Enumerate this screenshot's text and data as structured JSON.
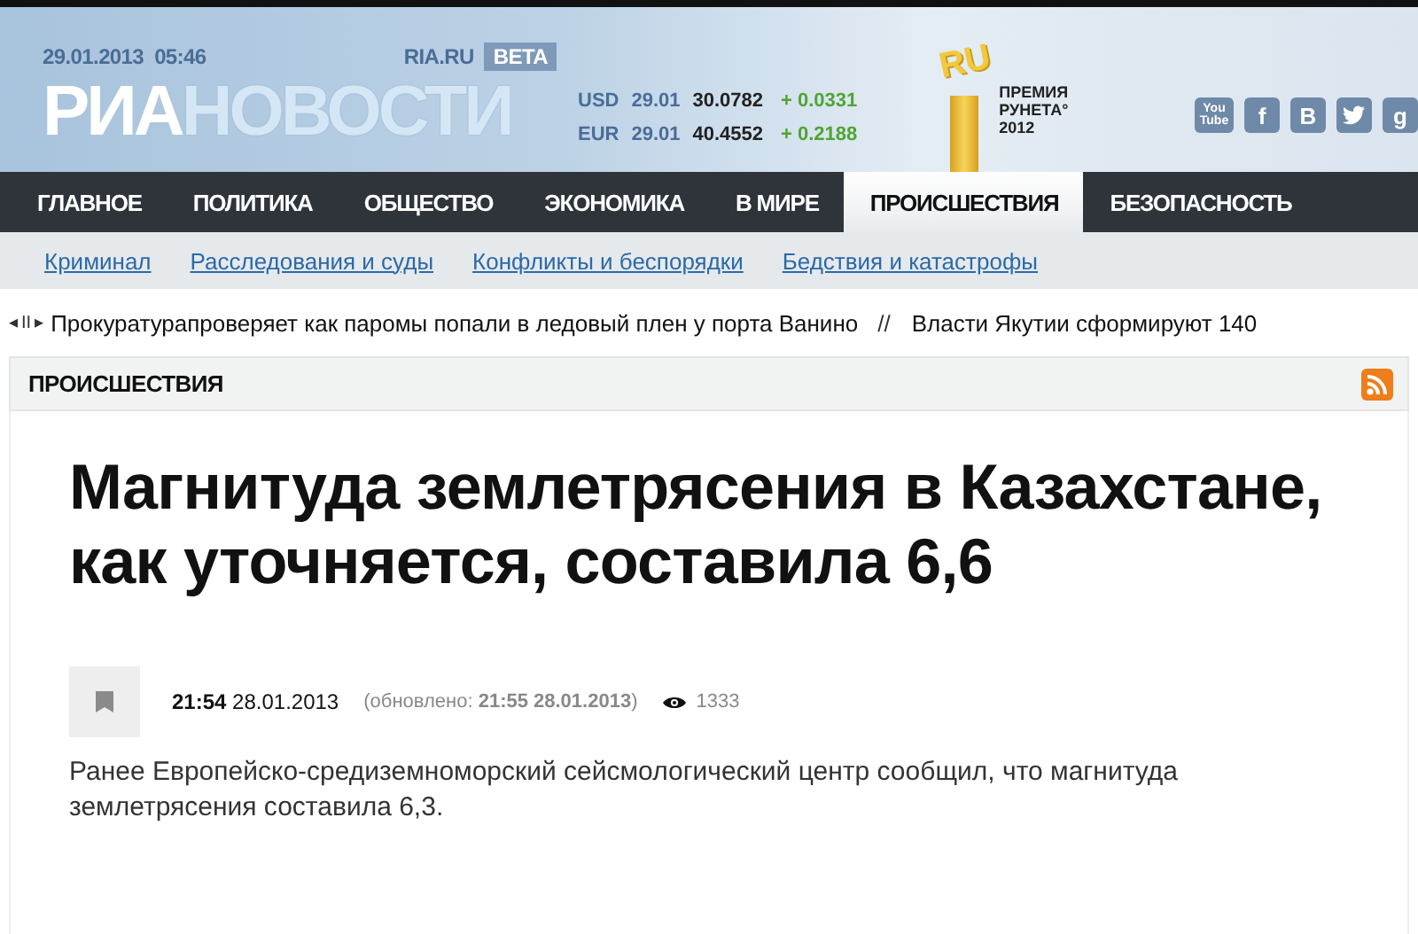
{
  "header": {
    "date": "29.01.2013",
    "time": "05:46",
    "site": "RIA.RU",
    "beta": "BETA",
    "logo": [
      "РИА",
      "НОВОСТИ"
    ],
    "rates": [
      {
        "currency": "USD",
        "date": "29.01",
        "value": "30.0782",
        "change": "+ 0.0331"
      },
      {
        "currency": "EUR",
        "date": "29.01",
        "value": "40.4552",
        "change": "+ 0.2188"
      }
    ],
    "award": {
      "badge": "RU",
      "lines": [
        "ПРЕМИЯ",
        "РУНЕТА°",
        "2012"
      ]
    },
    "social": [
      {
        "kind": "youtube",
        "label": "You Tube"
      },
      {
        "kind": "letter",
        "label": "f"
      },
      {
        "kind": "letter",
        "label": "B"
      },
      {
        "kind": "twitter"
      },
      {
        "kind": "letter",
        "label": "g"
      }
    ]
  },
  "nav": [
    {
      "label": "ГЛАВНОЕ",
      "selected": false
    },
    {
      "label": "ПОЛИТИКА",
      "selected": false
    },
    {
      "label": "ОБЩЕСТВО",
      "selected": false
    },
    {
      "label": "ЭКОНОМИКА",
      "selected": false
    },
    {
      "label": "В МИРЕ",
      "selected": false
    },
    {
      "label": "ПРОИСШЕСТВИЯ",
      "selected": true
    },
    {
      "label": "БЕЗОПАСНОСТЬ",
      "selected": false
    }
  ],
  "subnav": [
    "Криминал",
    "Расследования и суды",
    "Конфликты и беспорядки",
    "Бедствия и катастрофы"
  ],
  "ticker": {
    "controls": [
      "◂",
      "II",
      "▸"
    ],
    "separator": "//",
    "items": [
      "Прокуратурапроверяет как паромы попали в ледовый плен у порта Ванино",
      "Власти Якутии сформируют 140"
    ]
  },
  "section": {
    "title": "ПРОИСШЕСТВИЯ"
  },
  "article": {
    "headline": "Магнитуда землетрясения в Казахстане, как уточняется, составила 6,6",
    "time": "21:54",
    "date": "28.01.2013",
    "updated_label": "(обновлено:",
    "updated_time": "21:55 28.01.2013",
    "updated_close": ")",
    "views": "1333",
    "lead": "Ранее Европейско-средиземноморский сейсмологический центр сообщил, что магнитуда землетрясения составила 6,3."
  }
}
